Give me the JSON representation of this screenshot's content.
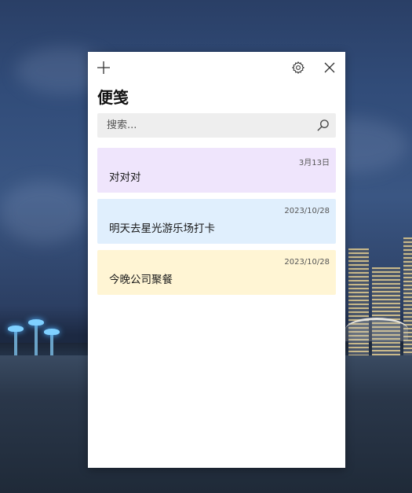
{
  "app": {
    "title": "便笺"
  },
  "toolbar": {
    "add_icon": "plus-icon",
    "settings_icon": "gear-icon",
    "close_icon": "close-icon"
  },
  "search": {
    "placeholder": "搜索...",
    "value": "",
    "icon": "search-icon"
  },
  "notes": [
    {
      "date": "3月13日",
      "text": "对对对",
      "color": "#efe5fc"
    },
    {
      "date": "2023/10/28",
      "text": "明天去星光游乐场打卡",
      "color": "#e0effd"
    },
    {
      "date": "2023/10/28",
      "text": "今晚公司聚餐",
      "color": "#fff5d4"
    }
  ]
}
